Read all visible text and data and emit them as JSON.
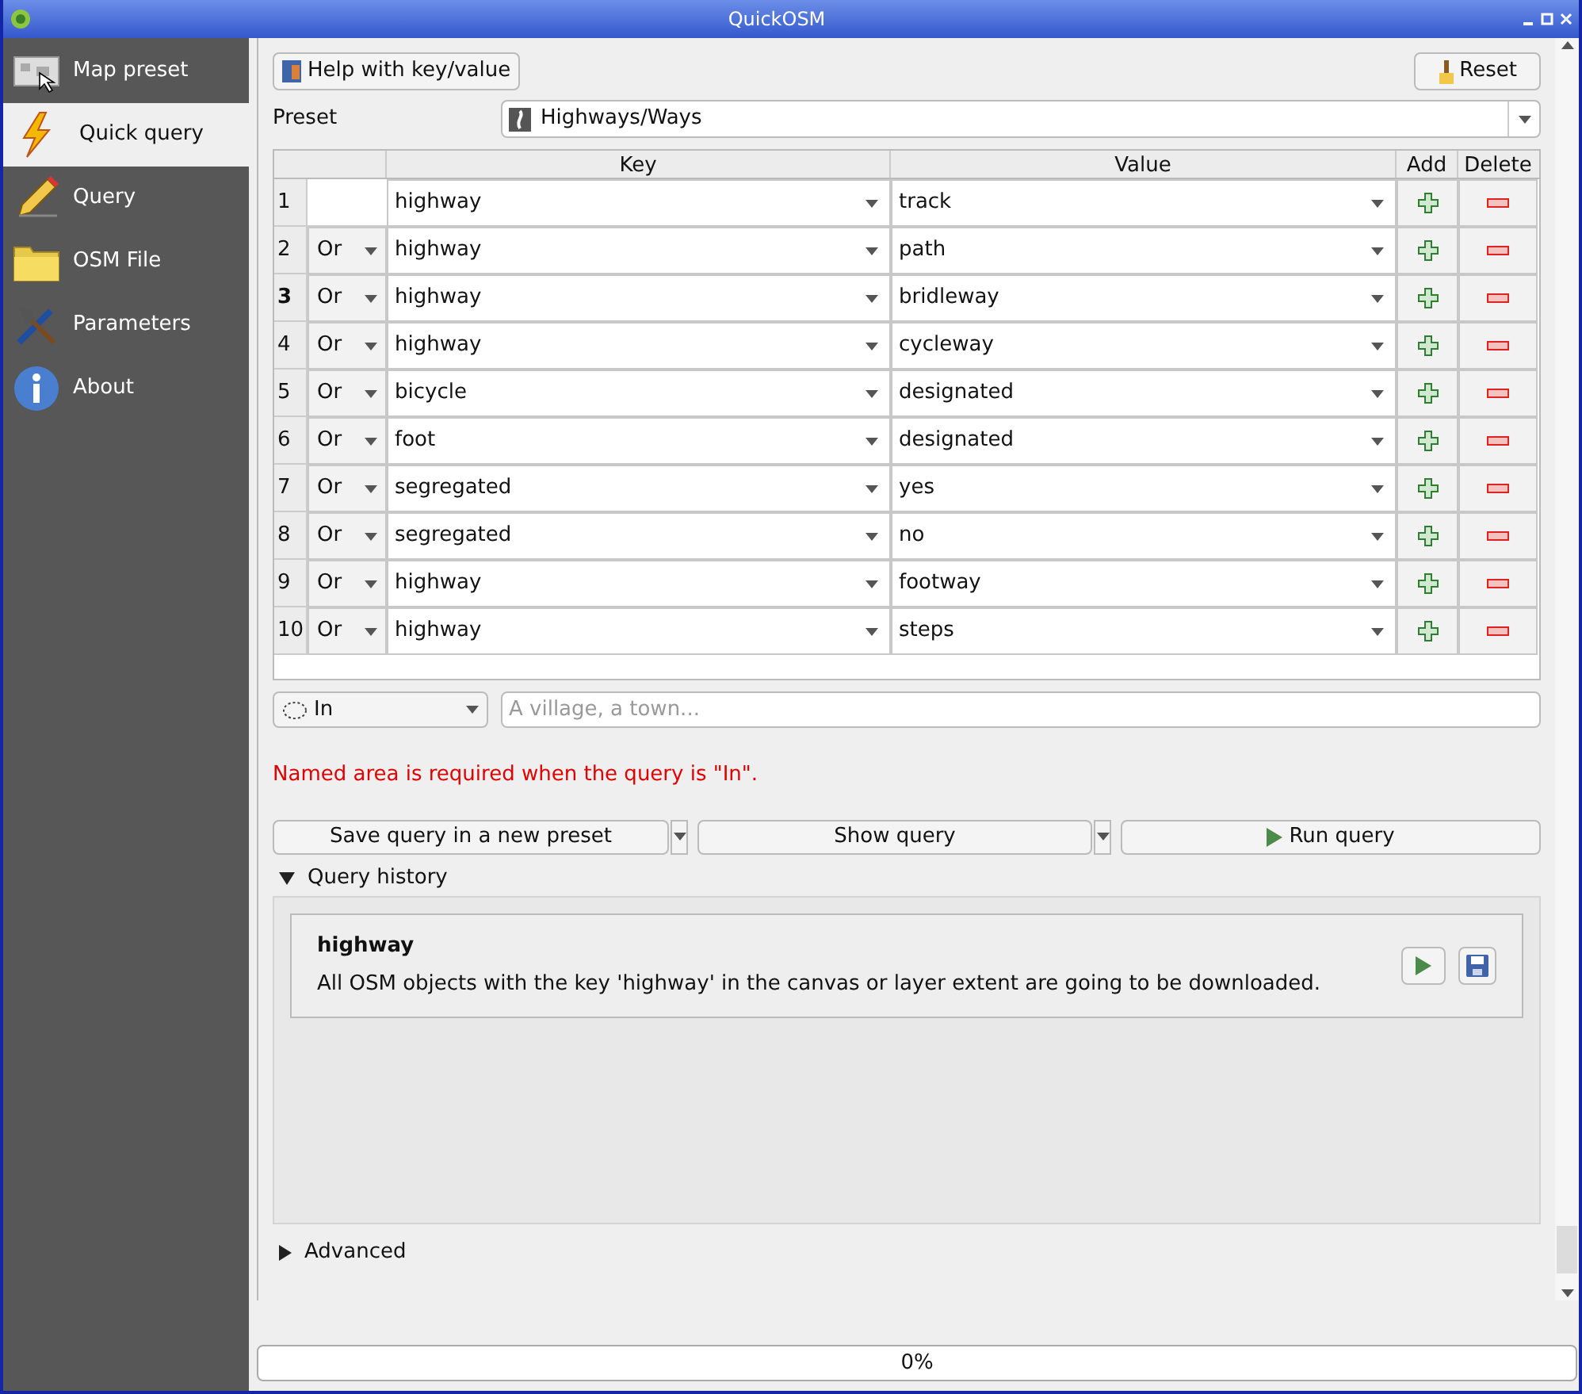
{
  "window": {
    "title": "QuickOSM"
  },
  "sidebar": {
    "items": [
      {
        "label": "Map preset",
        "selected": false
      },
      {
        "label": "Quick query",
        "selected": true
      },
      {
        "label": "Query",
        "selected": false
      },
      {
        "label": "OSM File",
        "selected": false
      },
      {
        "label": "Parameters",
        "selected": false
      },
      {
        "label": "About",
        "selected": false
      }
    ]
  },
  "help_button": "Help with key/value",
  "reset_button": "Reset",
  "preset": {
    "label": "Preset",
    "value": "Highways/Ways"
  },
  "table": {
    "columns": [
      "Key",
      "Value",
      "Add",
      "Delete"
    ],
    "rows": [
      {
        "number": "1",
        "current": false,
        "key": "highway",
        "value": "track"
      },
      {
        "number": "2",
        "current": false,
        "operator": "Or",
        "key": "highway",
        "value": "path"
      },
      {
        "number": "3",
        "current": true,
        "operator": "Or",
        "key": "highway",
        "value": "bridleway"
      },
      {
        "number": "4",
        "current": false,
        "operator": "Or",
        "key": "highway",
        "value": "cycleway"
      },
      {
        "number": "5",
        "current": false,
        "operator": "Or",
        "key": "bicycle",
        "value": "designated"
      },
      {
        "number": "6",
        "current": false,
        "operator": "Or",
        "key": "foot",
        "value": "designated"
      },
      {
        "number": "7",
        "current": false,
        "operator": "Or",
        "key": "segregated",
        "value": "yes"
      },
      {
        "number": "8",
        "current": false,
        "operator": "Or",
        "key": "segregated",
        "value": "no"
      },
      {
        "number": "9",
        "current": false,
        "operator": "Or",
        "key": "highway",
        "value": "footway"
      },
      {
        "number": "10",
        "current": false,
        "operator": "Or",
        "key": "highway",
        "value": "steps"
      }
    ]
  },
  "area": {
    "type": "In",
    "placeholder": "A village, a town..."
  },
  "error": "Named area is required when the query is \"In\".",
  "actions": {
    "save": "Save query in a new preset",
    "show": "Show query",
    "run": "Run query"
  },
  "history": {
    "title": "Query history",
    "expanded": true,
    "items": [
      {
        "title": "highway",
        "description": "All OSM objects with the key 'highway' in the canvas or layer extent are going to be downloaded."
      }
    ]
  },
  "advanced": {
    "title": "Advanced",
    "expanded": false
  },
  "progress": {
    "level": 0,
    "text": "0%"
  }
}
